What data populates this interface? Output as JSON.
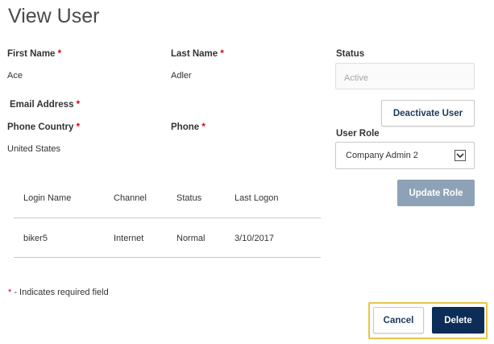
{
  "page": {
    "title": "View User"
  },
  "form": {
    "first_name_label": "First Name",
    "first_name_value": "Ace",
    "last_name_label": "Last Name",
    "last_name_value": "Adler",
    "email_label": "Email Address",
    "phone_country_label": "Phone Country",
    "phone_country_value": "United States",
    "phone_label": "Phone",
    "required_marker": "*"
  },
  "status_panel": {
    "label": "Status",
    "value": "Active",
    "deactivate_label": "Deactivate User",
    "user_role_label": "User Role",
    "user_role_value": "Company Admin 2",
    "update_role_label": "Update Role"
  },
  "logins_table": {
    "headers": [
      "Login Name",
      "Channel",
      "Status",
      "Last Logon"
    ],
    "rows": [
      [
        "biker5",
        "Internet",
        "Normal",
        "3/10/2017"
      ]
    ]
  },
  "footer": {
    "required_note_marker": "*",
    "required_note_text": " - Indicates required field",
    "cancel_label": "Cancel",
    "delete_label": "Delete"
  },
  "colors": {
    "primary": "#0c2d57",
    "disabled": "#8ea2b7",
    "required": "#d0021b",
    "highlight": "#e8c547"
  },
  "icons": {
    "select_chevron": "chevron-down-icon"
  }
}
